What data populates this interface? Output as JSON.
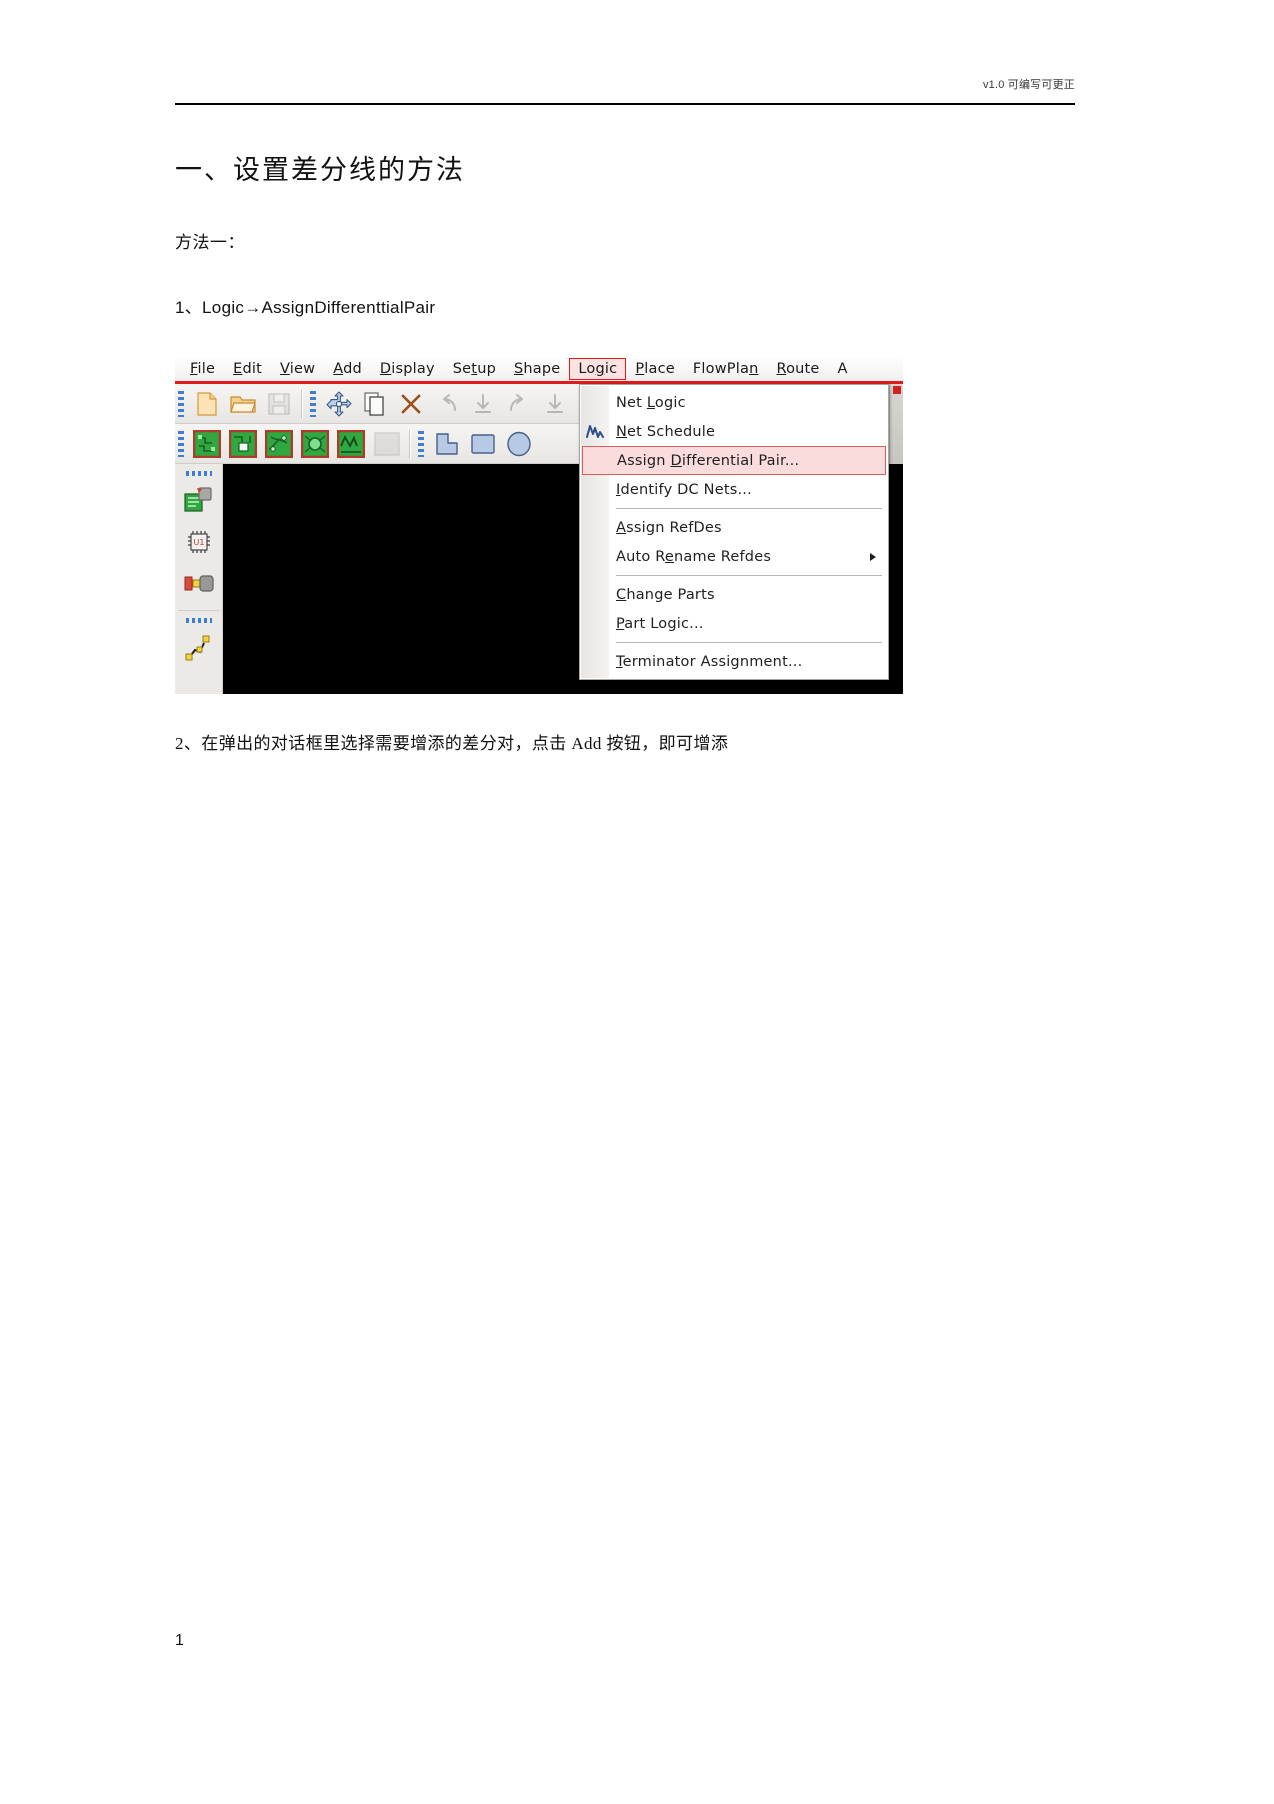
{
  "document": {
    "header_text": "v1.0 可编写可更正",
    "title": "一、设置差分线的方法",
    "method_label": "方法一：",
    "step1": "1、Logic→AssignDifferenttialPair",
    "step2": "2、在弹出的对话框里选择需要增添的差分对，点击 Add 按钮，即可增添",
    "page_number": "1"
  },
  "screenshot": {
    "menubar": {
      "items": [
        {
          "pre": "",
          "u": "F",
          "post": "ile",
          "active": false
        },
        {
          "pre": "",
          "u": "E",
          "post": "dit",
          "active": false
        },
        {
          "pre": "",
          "u": "V",
          "post": "iew",
          "active": false
        },
        {
          "pre": "",
          "u": "A",
          "post": "dd",
          "active": false
        },
        {
          "pre": "",
          "u": "D",
          "post": "isplay",
          "active": false
        },
        {
          "pre": "Se",
          "u": "t",
          "post": "up",
          "active": false
        },
        {
          "pre": "",
          "u": "S",
          "post": "hape",
          "active": false
        },
        {
          "pre": "Lo",
          "u": "g",
          "post": "ic",
          "active": true
        },
        {
          "pre": "",
          "u": "P",
          "post": "lace",
          "active": false
        },
        {
          "pre": "FlowPla",
          "u": "n",
          "post": "",
          "active": false
        },
        {
          "pre": "",
          "u": "R",
          "post": "oute",
          "active": false
        },
        {
          "pre": "A",
          "u": "",
          "post": "",
          "active": false
        }
      ]
    },
    "toolbar_row1": [
      {
        "icon": "new-file-icon",
        "enabled": true
      },
      {
        "icon": "open-folder-icon",
        "enabled": true
      },
      {
        "icon": "save-icon",
        "enabled": false
      },
      {
        "icon": "move-icon",
        "enabled": true
      },
      {
        "icon": "copy-icon",
        "enabled": true
      },
      {
        "icon": "delete-x-icon",
        "enabled": true
      },
      {
        "icon": "undo-icon",
        "enabled": false
      },
      {
        "icon": "undo-step-icon",
        "enabled": false
      },
      {
        "icon": "redo-icon",
        "enabled": false
      },
      {
        "icon": "redo-step-icon",
        "enabled": false
      }
    ],
    "toolbar_row2": [
      {
        "icon": "board-edit-icon",
        "enabled": true
      },
      {
        "icon": "board-pad-icon",
        "enabled": true
      },
      {
        "icon": "board-net-icon",
        "enabled": true
      },
      {
        "icon": "board-ratsnest-icon",
        "enabled": true
      },
      {
        "icon": "board-route-icon",
        "enabled": true
      },
      {
        "icon": "board-disabled-icon",
        "enabled": false
      },
      {
        "icon": "shape-polygon-icon",
        "enabled": true
      },
      {
        "icon": "shape-rectangle-icon",
        "enabled": true
      },
      {
        "icon": "shape-circle-icon",
        "enabled": true
      }
    ],
    "sidebar": {
      "group1": [
        {
          "icon": "placement-edit-icon"
        },
        {
          "icon": "component-refdes-icon"
        },
        {
          "icon": "swap-component-icon"
        }
      ],
      "group2": [
        {
          "icon": "route-path-icon"
        }
      ]
    },
    "logic_menu": {
      "items": [
        {
          "type": "item",
          "pre": "Net ",
          "u": "L",
          "post": "ogic",
          "icon": null,
          "submenu": false,
          "highlight": false
        },
        {
          "type": "item",
          "pre": "",
          "u": "N",
          "post": "et Schedule",
          "icon": "net-schedule-icon",
          "submenu": false,
          "highlight": false
        },
        {
          "type": "item",
          "pre": "Assign ",
          "u": "D",
          "post": "ifferential Pair...",
          "icon": null,
          "submenu": false,
          "highlight": true
        },
        {
          "type": "item",
          "pre": "",
          "u": "I",
          "post": "dentify DC Nets...",
          "icon": null,
          "submenu": false,
          "highlight": false
        },
        {
          "type": "separator"
        },
        {
          "type": "item",
          "pre": "",
          "u": "A",
          "post": "ssign RefDes",
          "icon": null,
          "submenu": false,
          "highlight": false
        },
        {
          "type": "item",
          "pre": "Auto R",
          "u": "e",
          "post": "name Refdes",
          "icon": null,
          "submenu": true,
          "highlight": false
        },
        {
          "type": "separator"
        },
        {
          "type": "item",
          "pre": "",
          "u": "C",
          "post": "hange Parts",
          "icon": null,
          "submenu": false,
          "highlight": false
        },
        {
          "type": "item",
          "pre": "",
          "u": "P",
          "post": "art Logic...",
          "icon": null,
          "submenu": false,
          "highlight": false
        },
        {
          "type": "separator"
        },
        {
          "type": "item",
          "pre": "",
          "u": "T",
          "post": "erminator Assignment...",
          "icon": null,
          "submenu": false,
          "highlight": false
        }
      ]
    },
    "colors": {
      "menu_highlight_border": "#e01b1b",
      "menu_highlight_fill": "#fbdcdc",
      "canvas": "#000000",
      "toolbar_bg": "#eceae7"
    }
  }
}
